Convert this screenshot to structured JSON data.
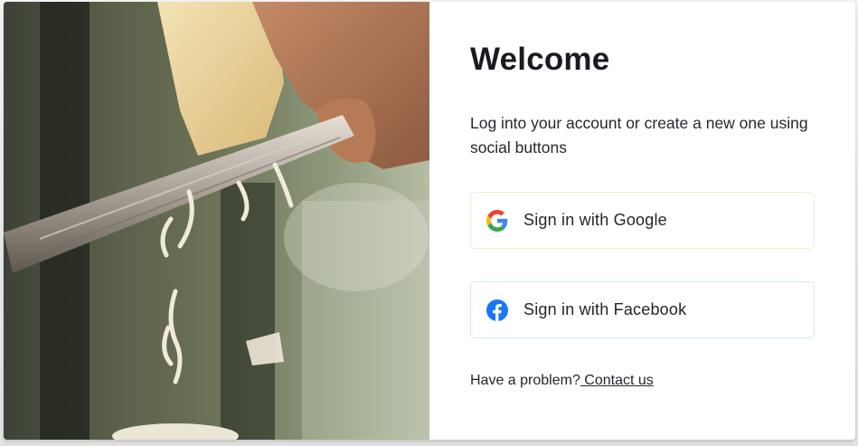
{
  "login": {
    "title": "Welcome",
    "subtitle": "Log into your account or create a new one using social buttons",
    "google_button": {
      "label": "Sign in with Google",
      "icon": "google-icon"
    },
    "facebook_button": {
      "label": "Sign in with Facebook",
      "icon": "facebook-icon"
    },
    "help_text": "Have a problem?",
    "contact_link": " Contact us"
  },
  "hero_image": {
    "description_icon": "cheese-grater-photo"
  },
  "colors": {
    "google_border": "#f3ecd4",
    "facebook_border": "#d3e6f3",
    "facebook_blue": "#1877f2",
    "text": "#181b21"
  }
}
